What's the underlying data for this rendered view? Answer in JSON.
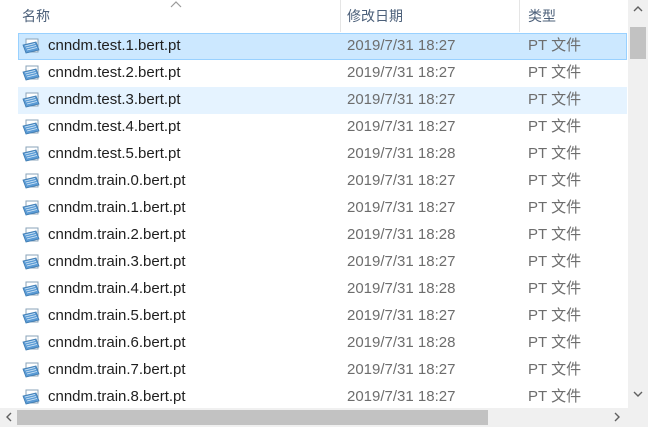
{
  "header": {
    "name_label": "名称",
    "date_label": "修改日期",
    "type_label": "类型",
    "sort": "ascending-by-name"
  },
  "colors": {
    "selected_bg": "#cce8ff",
    "selected_border": "#99d1ff",
    "hover_bg": "#e5f3ff",
    "header_text": "#4c607a",
    "secondary_text": "#6d6d6d"
  },
  "files": [
    {
      "name": "cnndm.test.1.bert.pt",
      "date": "2019/7/31 18:27",
      "type": "PT 文件",
      "state": "selected",
      "icon": "file-icon"
    },
    {
      "name": "cnndm.test.2.bert.pt",
      "date": "2019/7/31 18:27",
      "type": "PT 文件",
      "state": "normal",
      "icon": "file-icon"
    },
    {
      "name": "cnndm.test.3.bert.pt",
      "date": "2019/7/31 18:27",
      "type": "PT 文件",
      "state": "hover",
      "icon": "file-icon"
    },
    {
      "name": "cnndm.test.4.bert.pt",
      "date": "2019/7/31 18:27",
      "type": "PT 文件",
      "state": "normal",
      "icon": "file-icon"
    },
    {
      "name": "cnndm.test.5.bert.pt",
      "date": "2019/7/31 18:28",
      "type": "PT 文件",
      "state": "normal",
      "icon": "file-icon"
    },
    {
      "name": "cnndm.train.0.bert.pt",
      "date": "2019/7/31 18:27",
      "type": "PT 文件",
      "state": "normal",
      "icon": "file-icon"
    },
    {
      "name": "cnndm.train.1.bert.pt",
      "date": "2019/7/31 18:27",
      "type": "PT 文件",
      "state": "normal",
      "icon": "file-icon"
    },
    {
      "name": "cnndm.train.2.bert.pt",
      "date": "2019/7/31 18:28",
      "type": "PT 文件",
      "state": "normal",
      "icon": "file-icon"
    },
    {
      "name": "cnndm.train.3.bert.pt",
      "date": "2019/7/31 18:27",
      "type": "PT 文件",
      "state": "normal",
      "icon": "file-icon"
    },
    {
      "name": "cnndm.train.4.bert.pt",
      "date": "2019/7/31 18:28",
      "type": "PT 文件",
      "state": "normal",
      "icon": "file-icon"
    },
    {
      "name": "cnndm.train.5.bert.pt",
      "date": "2019/7/31 18:27",
      "type": "PT 文件",
      "state": "normal",
      "icon": "file-icon"
    },
    {
      "name": "cnndm.train.6.bert.pt",
      "date": "2019/7/31 18:28",
      "type": "PT 文件",
      "state": "normal",
      "icon": "file-icon"
    },
    {
      "name": "cnndm.train.7.bert.pt",
      "date": "2019/7/31 18:27",
      "type": "PT 文件",
      "state": "normal",
      "icon": "file-icon"
    },
    {
      "name": "cnndm.train.8.bert.pt",
      "date": "2019/7/31 18:27",
      "type": "PT 文件",
      "state": "normal",
      "icon": "file-icon"
    }
  ]
}
